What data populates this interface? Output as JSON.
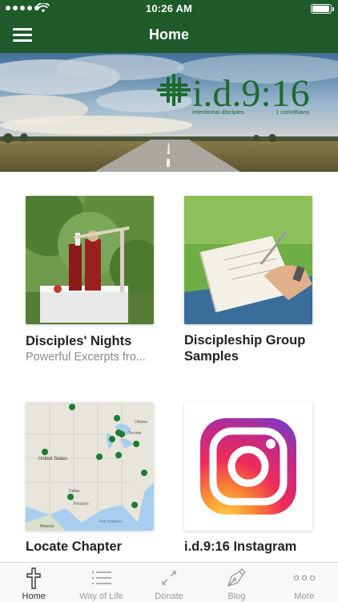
{
  "status_bar": {
    "time": "10:26 AM"
  },
  "header": {
    "title": "Home",
    "menu_icon": "hamburger-menu-icon"
  },
  "banner": {
    "logo_text": "i.d.9:16",
    "tagline_left": "intentional disciples",
    "tagline_right": "1 corinthians"
  },
  "tiles": [
    {
      "title": "Disciples' Nights",
      "subtitle": "Powerful Excerpts fro..."
    },
    {
      "title": "Discipleship Group Samples"
    },
    {
      "title": "Locate Chapter"
    },
    {
      "title": "i.d.9:16 Instagram"
    }
  ],
  "map_labels": {
    "country": "United States",
    "mexico": "Mexico",
    "gulf": "Gulf of Mexico",
    "ottawa": "Ottawa",
    "toronto": "Toronto",
    "dallas": "Dallas",
    "houston": "Houston"
  },
  "tabbar": [
    {
      "label": "Home",
      "icon": "cross-icon",
      "active": true
    },
    {
      "label": "Way of Life",
      "icon": "list-icon"
    },
    {
      "label": "Donate",
      "icon": "arrows-icon"
    },
    {
      "label": "Blog",
      "icon": "pen-nib-icon"
    },
    {
      "label": "More",
      "icon": "more-dots-icon"
    }
  ],
  "colors": {
    "header": "#1f5a2b",
    "brand_green": "#1e6b2e",
    "tab_inactive": "#9a9a9a"
  }
}
